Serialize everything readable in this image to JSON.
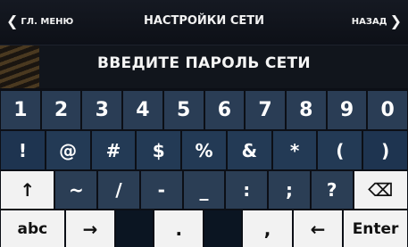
{
  "header": {
    "back_left_label": "ГЛ. МЕНЮ",
    "title": "НАСТРОЙКИ СЕТИ",
    "back_right_label": "НАЗАД"
  },
  "prompt": "ВВЕДИТЕ ПАРОЛЬ СЕТИ",
  "keyboard": {
    "row1": [
      "1",
      "2",
      "3",
      "4",
      "5",
      "6",
      "7",
      "8",
      "9",
      "0"
    ],
    "row2": [
      "!",
      "@",
      "#",
      "$",
      "%",
      "&",
      "*",
      "(",
      ")"
    ],
    "row3": [
      "↑",
      "~",
      "/",
      "-",
      "_",
      ":",
      ";",
      "?",
      "⌫"
    ],
    "row4": [
      "abc",
      "→",
      "",
      ".",
      "",
      ",",
      "←",
      "Enter"
    ]
  },
  "icons": {
    "left_chevron": "chevron-left-icon",
    "right_chevron": "chevron-right-icon",
    "shift": "shift-icon",
    "backspace": "backspace-icon"
  },
  "colors": {
    "key_dark_blue": "#2a3d55",
    "key_light": "#f2f2f2",
    "background": "#0c0f16"
  }
}
